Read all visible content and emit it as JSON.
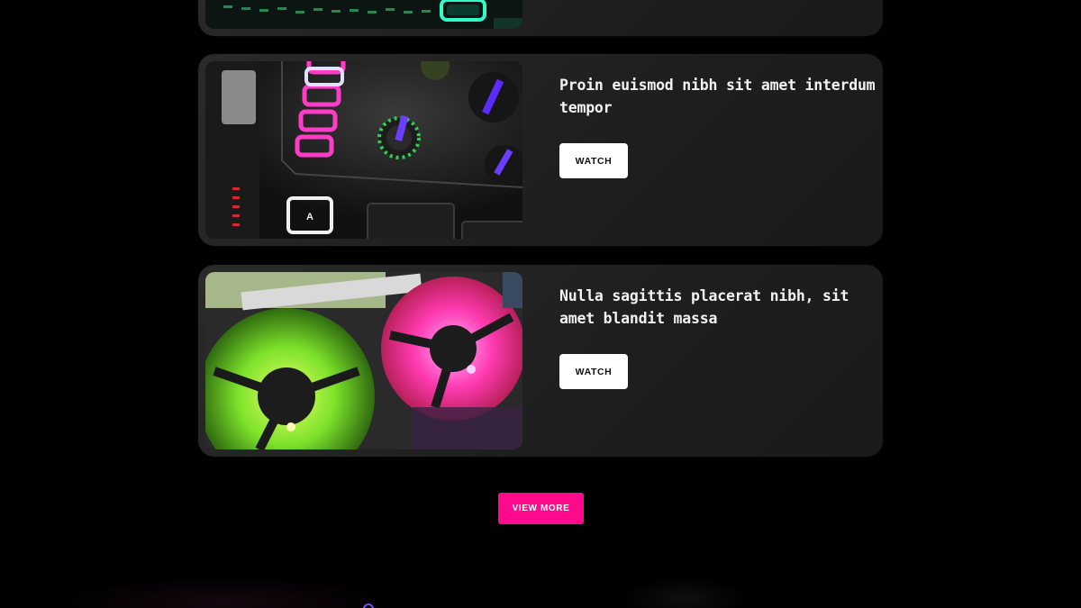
{
  "colors": {
    "page_background": "#000000",
    "card_background": "#222222",
    "watch_button_bg": "#ffffff",
    "view_more_bg": "#ff0a8c",
    "accent_purple": "#7a4cff"
  },
  "videos": [
    {
      "title": "",
      "thumbnail": "mixer-teal-buttons-image",
      "button_label": ""
    },
    {
      "title": "Proin euismod nibh sit amet interdum tempor",
      "thumbnail": "mixer-pink-pads-image",
      "button_label": "WATCH"
    },
    {
      "title": "Nulla sagittis placerat nibh, sit amet blandit massa",
      "thumbnail": "rgb-fans-image",
      "button_label": "WATCH"
    }
  ],
  "view_more": {
    "label": "VIEW MORE"
  }
}
